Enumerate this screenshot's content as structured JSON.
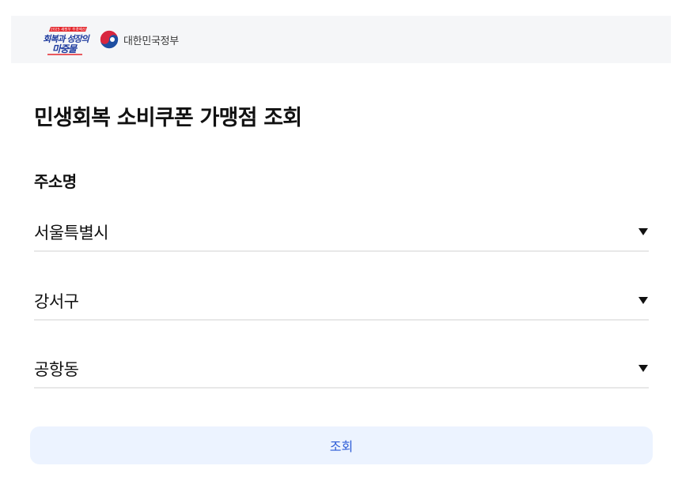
{
  "header": {
    "campaign_logo": {
      "icon": "campaign-logo",
      "top_line": "2025 새정부 추경예산",
      "line1": "회복과 성장의",
      "line2": "마중물",
      "colors": {
        "primary": "#1d3a9e",
        "accent": "#e4252b"
      }
    },
    "gov_logo": {
      "icon": "taegeuk-emblem-icon",
      "name": "대한민국정부",
      "colors": {
        "red": "#d8263f",
        "blue": "#1e4ea1"
      }
    }
  },
  "page": {
    "title": "민생회복 소비쿠폰 가맹점 조회"
  },
  "form": {
    "address_label": "주소명",
    "selects": [
      {
        "value": "서울특별시",
        "icon": "caret-down-icon"
      },
      {
        "value": "강서구",
        "icon": "caret-down-icon"
      },
      {
        "value": "공항동",
        "icon": "caret-down-icon"
      }
    ],
    "submit_label": "조회"
  },
  "colors": {
    "header_bg": "#f5f6f8",
    "button_bg": "#ecf3ff",
    "button_text": "#2c5bd6",
    "divider": "#e8e8e8"
  }
}
